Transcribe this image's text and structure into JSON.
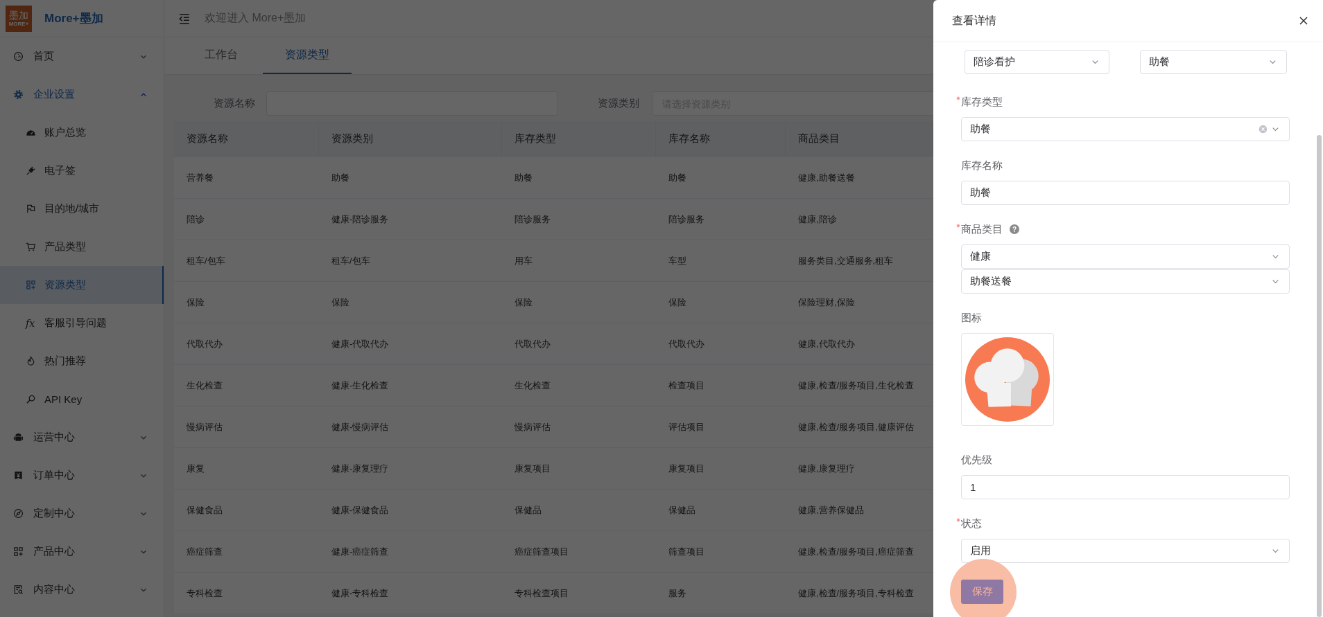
{
  "logo": {
    "mark": "墨加",
    "mark_sub": "MORE+",
    "name": "More+墨加"
  },
  "sidebar": {
    "items": [
      {
        "label": "首页",
        "expanded": false,
        "selected": false
      },
      {
        "label": "企业设置",
        "expanded": true,
        "selected": true,
        "children": [
          {
            "label": "账户总览",
            "selected": false
          },
          {
            "label": "电子签",
            "selected": false
          },
          {
            "label": "目的地/城市",
            "selected": false
          },
          {
            "label": "产品类型",
            "selected": false
          },
          {
            "label": "资源类型",
            "selected": true
          },
          {
            "label": "客服引导问题",
            "selected": false,
            "icon_glyph": "fx"
          },
          {
            "label": "热门推荐",
            "selected": false
          },
          {
            "label": "API Key",
            "selected": false
          }
        ]
      },
      {
        "label": "运营中心",
        "expanded": false,
        "selected": false
      },
      {
        "label": "订单中心",
        "expanded": false,
        "selected": false
      },
      {
        "label": "定制中心",
        "expanded": false,
        "selected": false
      },
      {
        "label": "产品中心",
        "expanded": false,
        "selected": false
      },
      {
        "label": "内容中心",
        "expanded": false,
        "selected": false
      }
    ]
  },
  "header": {
    "welcome": "欢迎进入 More+墨加"
  },
  "tabs": [
    {
      "label": "工作台",
      "selected": false
    },
    {
      "label": "资源类型",
      "selected": true
    }
  ],
  "filters": [
    {
      "label": "资源名称",
      "kind": "input"
    },
    {
      "label": "资源类别",
      "kind": "select",
      "placeholder": "请选择资源类别"
    }
  ],
  "table": {
    "columns": [
      "资源名称",
      "资源类别",
      "库存类型",
      "库存名称",
      "商品类目"
    ],
    "rows": [
      [
        "营养餐",
        "助餐",
        "助餐",
        "助餐",
        "健康,助餐送餐"
      ],
      [
        "陪诊",
        "健康-陪诊服务",
        "陪诊服务",
        "陪诊服务",
        "健康,陪诊"
      ],
      [
        "租车/包车",
        "租车/包车",
        "用车",
        "车型",
        "服务类目,交通服务,租车"
      ],
      [
        "保险",
        "保险",
        "保险",
        "保险",
        "保险理财,保险"
      ],
      [
        "代取代办",
        "健康-代取代办",
        "代取代办",
        "代取代办",
        "健康,代取代办"
      ],
      [
        "生化检查",
        "健康-生化检查",
        "生化检查",
        "检查项目",
        "健康,检查/服务项目,生化检查"
      ],
      [
        "慢病评估",
        "健康-慢病评估",
        "慢病评估",
        "评估项目",
        "健康,检查/服务项目,健康评估"
      ],
      [
        "康复",
        "健康-康复理疗",
        "康复项目",
        "康复项目",
        "健康,康复理疗"
      ],
      [
        "保健食品",
        "健康-保健食品",
        "保健品",
        "保健品",
        "健康,营养保健品"
      ],
      [
        "癌症筛查",
        "健康-癌症筛查",
        "癌症筛查项目",
        "筛查项目",
        "健康,检查/服务项目,癌症筛查"
      ],
      [
        "专科检查",
        "健康-专科检查",
        "专科检查项目",
        "服务",
        "健康,检查/服务项目,专科检查"
      ]
    ]
  },
  "drawer": {
    "title": "查看详情",
    "top_selects": [
      "陪诊看护",
      "助餐"
    ],
    "fields": [
      {
        "kind": "select",
        "label": "库存类型",
        "required": true,
        "clearable": true,
        "values": [
          "助餐"
        ]
      },
      {
        "kind": "input",
        "label": "库存名称",
        "required": false,
        "value": "助餐"
      },
      {
        "kind": "select",
        "label": "商品类目",
        "required": true,
        "help": "?",
        "values": [
          "健康",
          "助餐送餐"
        ]
      },
      {
        "kind": "image",
        "label": "图标",
        "required": false
      },
      {
        "kind": "input",
        "label": "优先级",
        "required": false,
        "value": "1"
      },
      {
        "kind": "select",
        "label": "状态",
        "required": true,
        "values": [
          "启用"
        ]
      }
    ],
    "save": {
      "label": "保存",
      "pressed": true
    }
  }
}
